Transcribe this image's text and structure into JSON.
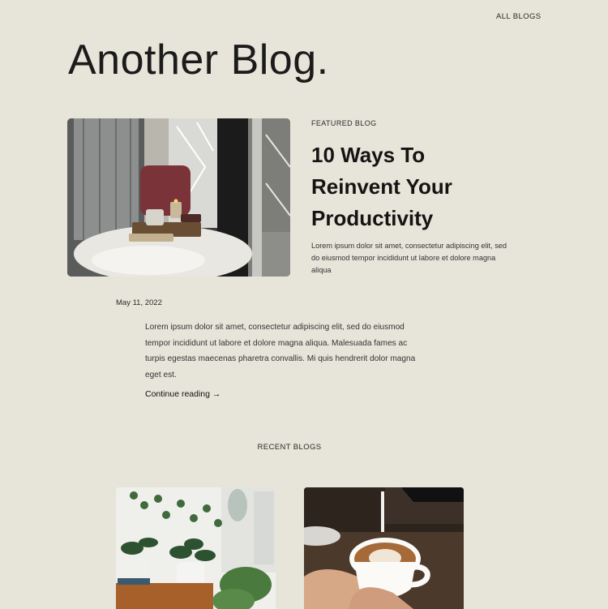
{
  "nav": {
    "all_blogs": "ALL BLOGS"
  },
  "page": {
    "title": "Another Blog."
  },
  "featured": {
    "label": "FEATURED BLOG",
    "title": "10 Ways To Reinvent Your Productivity",
    "excerpt": "Lorem ipsum dolor sit amet, consectetur adipiscing elit, sed do eiusmod tempor incididunt ut labore et dolore magna aliqua",
    "date": "May 11, 2022",
    "body": "Lorem ipsum dolor sit amet, consectetur adipiscing elit, sed do eiusmod tempor incididunt ut labore et dolore magna aliqua. Malesuada fames ac turpis egestas maecenas pharetra convallis. Mi quis hendrerit dolor magna eget est.",
    "continue_label": "Continue reading →",
    "image_icon": "window-seat-photo"
  },
  "recent": {
    "label": "RECENT BLOGS",
    "cards": [
      {
        "image_icon": "houseplants-photo"
      },
      {
        "image_icon": "latte-art-photo"
      }
    ]
  },
  "colors": {
    "background": "#e7e4d9",
    "text": "#1b1b1b"
  }
}
